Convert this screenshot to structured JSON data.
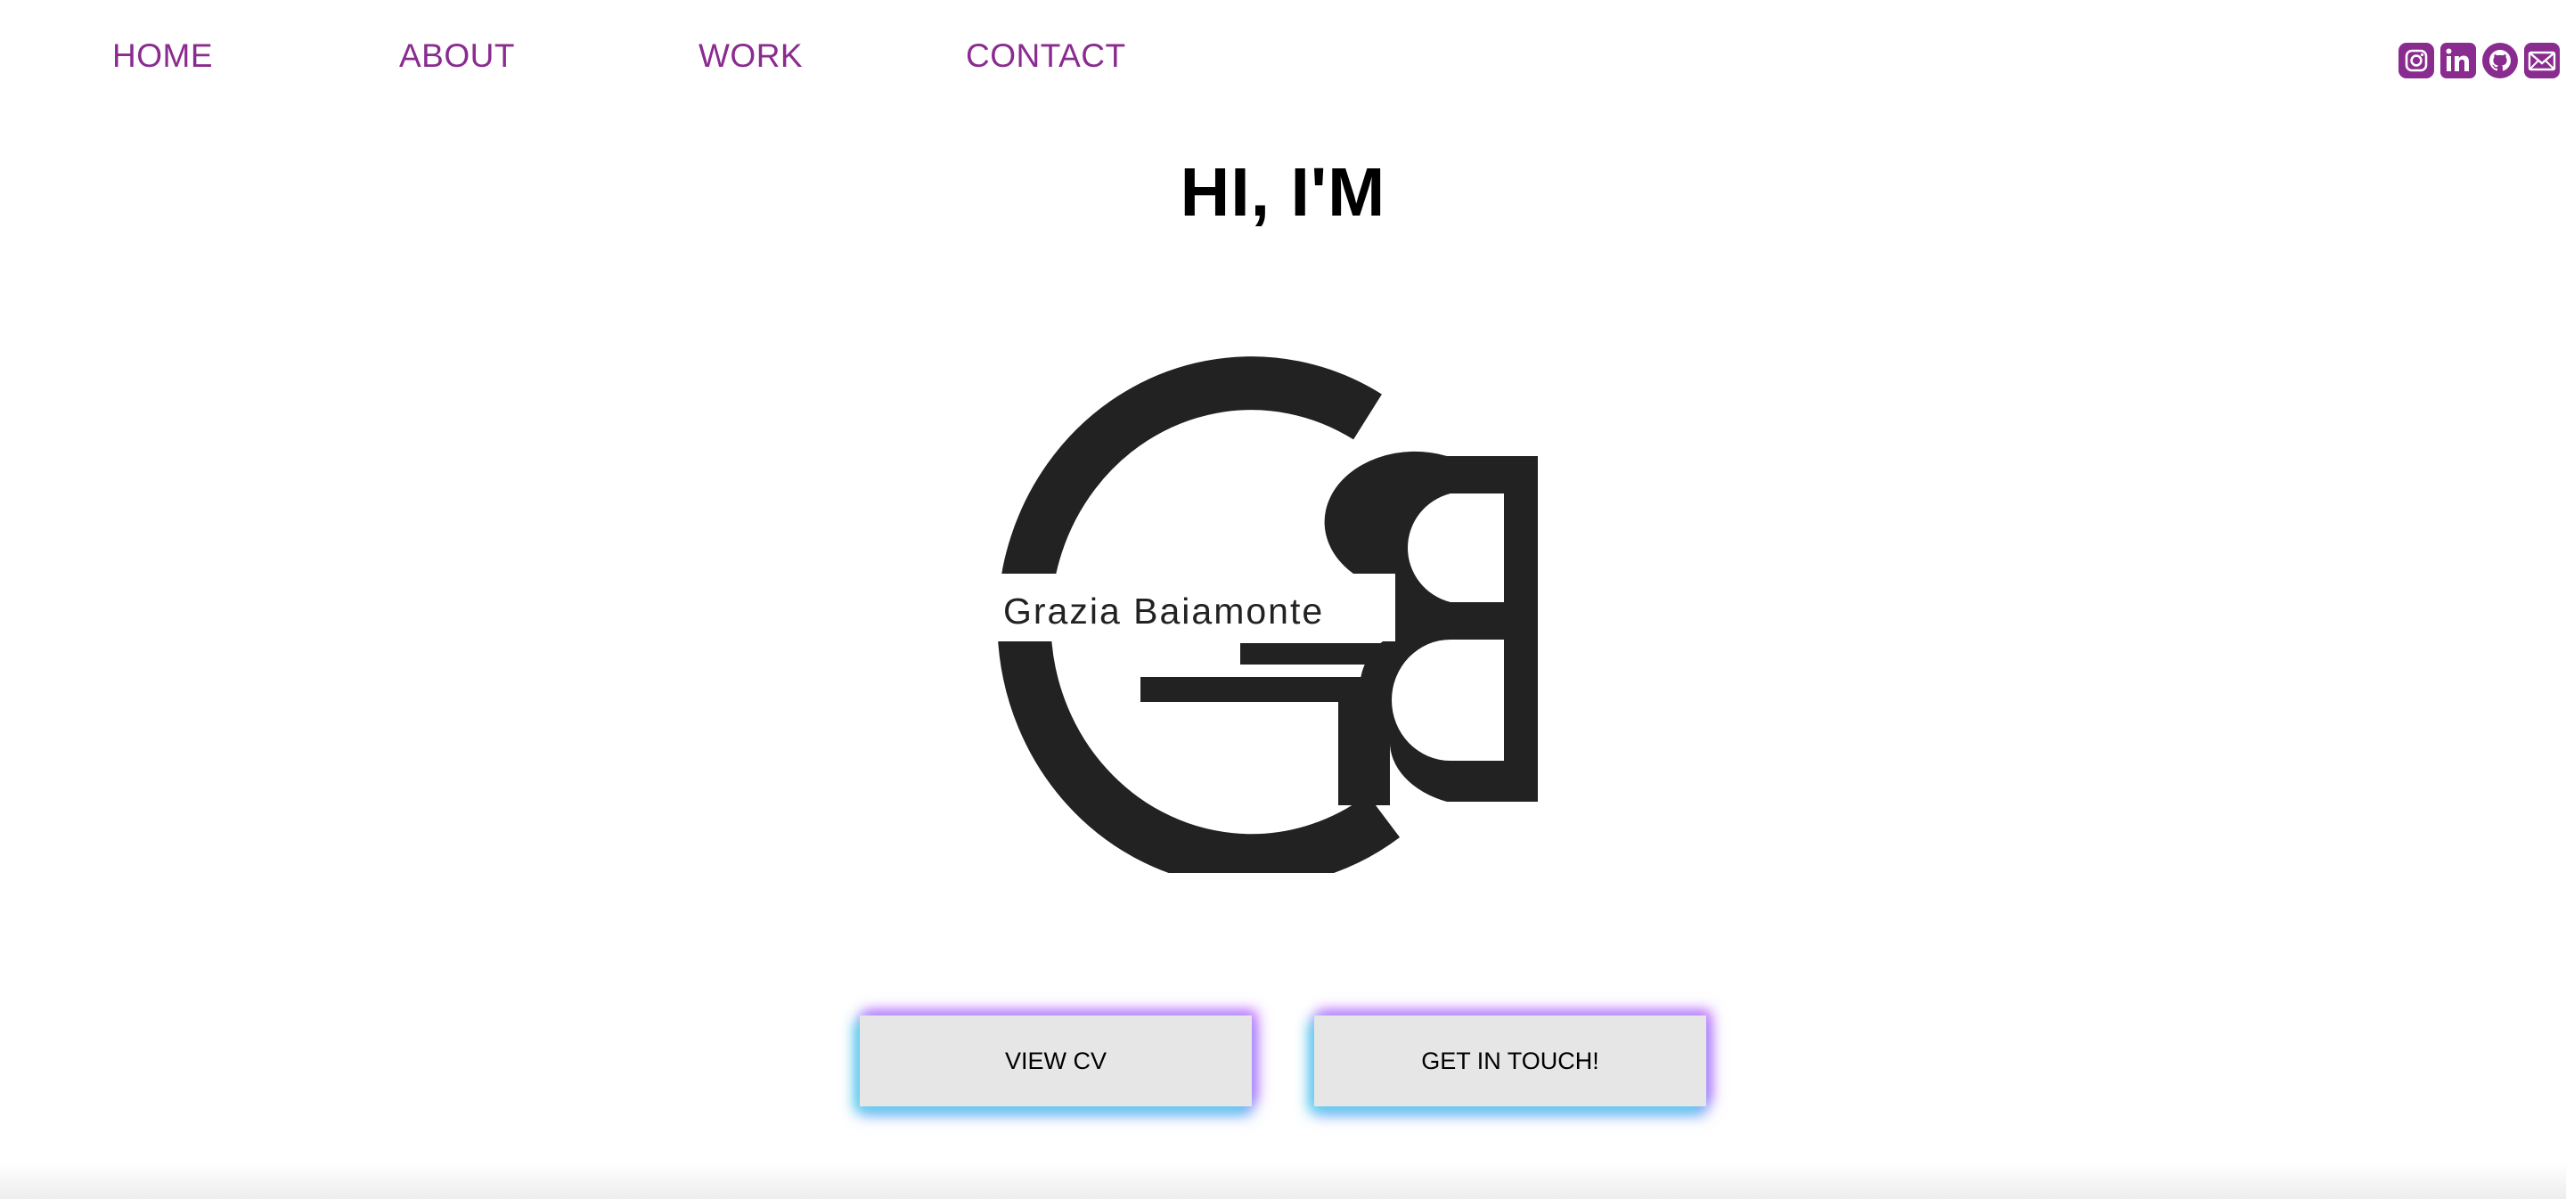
{
  "nav": {
    "items": [
      {
        "label": "HOME"
      },
      {
        "label": "ABOUT"
      },
      {
        "label": "WORK"
      },
      {
        "label": "CONTACT"
      }
    ]
  },
  "social": {
    "icons": [
      "instagram-icon",
      "linkedin-icon",
      "github-icon",
      "mail-icon"
    ],
    "color": "#8a2b8f"
  },
  "hero": {
    "title": "HI, I'M",
    "logo_name": "Grazia Baiamonte",
    "logo_monogram": "GB"
  },
  "buttons": {
    "view_cv": "VIEW CV",
    "get_in_touch": "GET IN TOUCH!"
  },
  "colors": {
    "accent": "#8a2b8f",
    "logo": "#222222",
    "button_bg": "#e6e6e6"
  }
}
